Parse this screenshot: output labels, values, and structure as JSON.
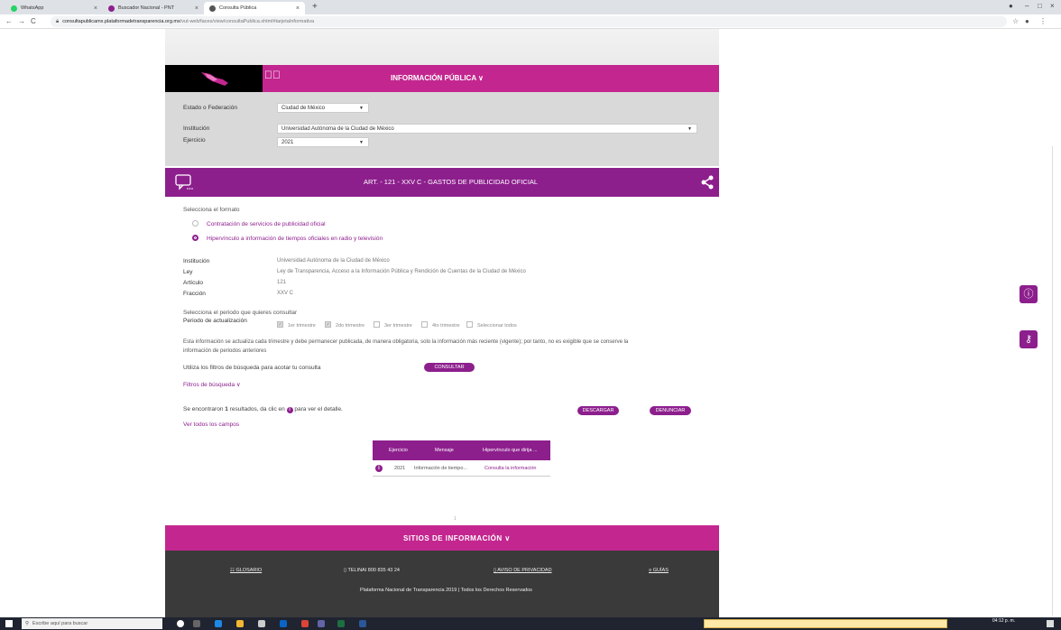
{
  "browser": {
    "tabs": [
      {
        "label": "WhatsApp",
        "color": "#25d366"
      },
      {
        "label": "Buscador Nacional - PNT",
        "color": "#8d1f8d"
      },
      {
        "label": "Consulta Pública",
        "color": "#555555"
      }
    ],
    "url_host": "consultapublicamx.plataformadetransparencia.org.mx",
    "url_path": "/vut-web/faces/view/consultaPublica.xhtml#tarjetaInformativa"
  },
  "header": {
    "menu_title": "INFORMACIÓN PÚBLICA ∨"
  },
  "filters": {
    "estado_label": "Estado o Federación",
    "estado_value": "Ciudad de México",
    "institucion_label": "Institución",
    "institucion_value": "Universidad Autónoma de la Ciudad de México",
    "ejercicio_label": "Ejercicio",
    "ejercicio_value": "2021"
  },
  "article": {
    "title": "ART. - 121 - XXV C - GASTOS DE PUBLICIDAD OFICIAL"
  },
  "format": {
    "prompt": "Selecciona el formato",
    "option1": "Contratación de servicios de publicidad oficial",
    "option2": "Hipervínculo a información de tiempos oficiales en radio y televisión"
  },
  "details": {
    "institucion_label": "Institución",
    "institucion_value": "Universidad Autónoma de la Ciudad de México",
    "ley_label": "Ley",
    "ley_value": "Ley de Transparencia, Acceso a la Información Pública y Rendición de Cuentas de la Ciudad de México",
    "articulo_label": "Artículo",
    "articulo_value": "121",
    "fraccion_label": "Fracción",
    "fraccion_value": "XXV C"
  },
  "period": {
    "prompt": "Selecciona el periodo que quieres consultar",
    "label": "Periodo de actualización",
    "q1": "1er trimestre",
    "q2": "2do trimestre",
    "q3": "3er trimestre",
    "q4": "4to trimestre",
    "all": "Seleccionar todos"
  },
  "notice": {
    "line1": "Esta información se actualiza cada trimestre y debe permanecer publicada, de manera obligatoria, solo la información más reciente (vigente); por tanto, no es exigible que se conserve la",
    "line2": "información de periodos anteriores"
  },
  "search": {
    "hint": "Utiliza los filtros de búsqueda para acotar tu consulta",
    "consultar": "CONSULTAR",
    "filters_toggle": "Filtros de búsqueda ∨"
  },
  "results_info": {
    "prefix": "Se encontraron",
    "count": "1",
    "suffix": "resultados, da clic en",
    "suffix2": "para ver el detalle.",
    "descargar": "DESCARGAR",
    "denunciar": "DENUNCIAR",
    "ver_todos": "Ver todos los campos"
  },
  "table": {
    "headers": [
      "Ejercicio",
      "Mensaje",
      "Hipervínculo que dirija ..."
    ],
    "row": [
      "2021",
      "Información de tiempo...",
      "Consulta la información"
    ]
  },
  "pager": "1",
  "footer": {
    "sitios": "SITIOS DE INFORMACIÓN ∨",
    "glosario": "GLOSARIO",
    "telinai": "TELINAI 800 835 43 24",
    "aviso": "AVISO DE PRIVACIDAD",
    "guias": "GUÍAS",
    "copyright": "Plataforma Nacional de Transparencia 2019 | Todos los Derechos Reservados"
  },
  "taskbar": {
    "search_placeholder": "Escribe aquí para buscar",
    "clock": "04:12 p. m."
  }
}
